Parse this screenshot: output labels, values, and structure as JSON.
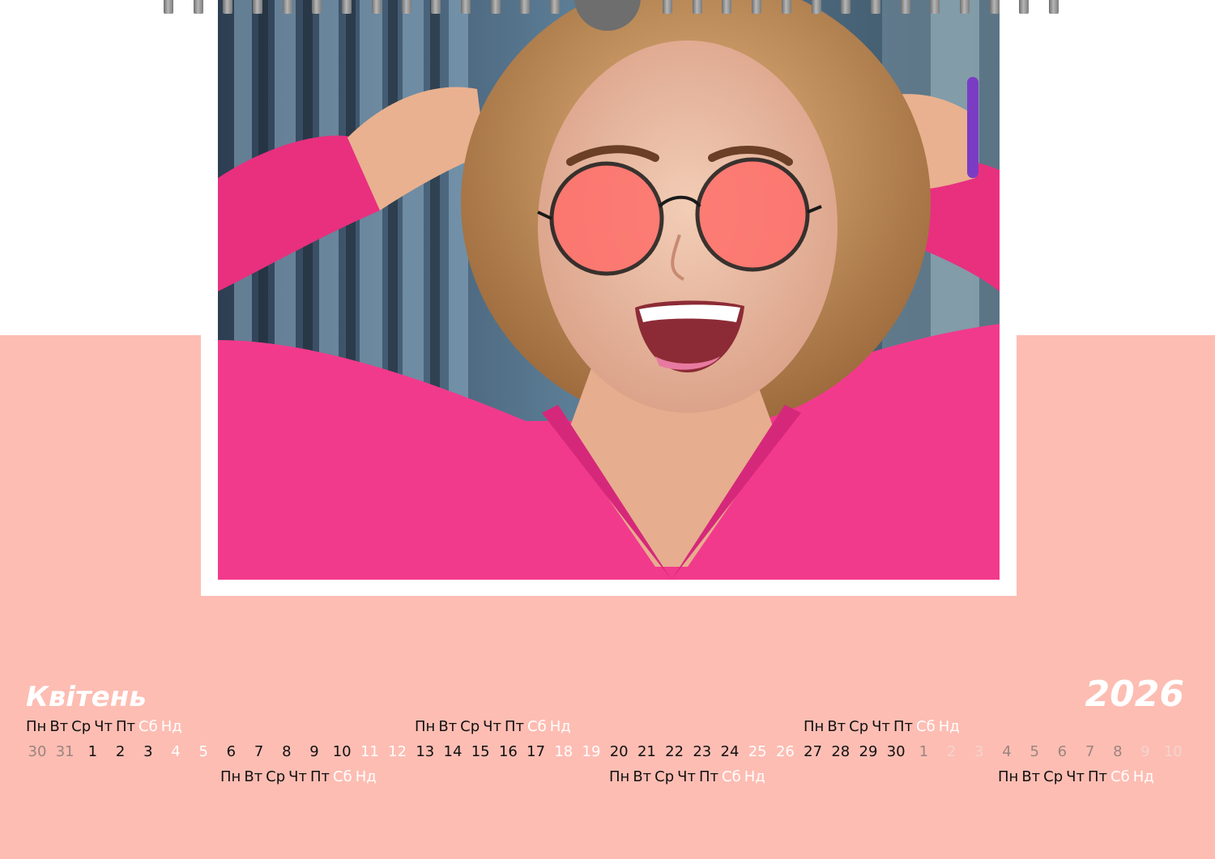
{
  "calendar": {
    "month": "Квітень",
    "year": "2026",
    "weekday_labels": [
      "Пн",
      "Вт",
      "Ср",
      "Чт",
      "Пт",
      "Сб",
      "Нд"
    ],
    "weekday_rows": 6,
    "days": [
      {
        "n": "30",
        "kind": "other"
      },
      {
        "n": "31",
        "kind": "other"
      },
      {
        "n": "1",
        "kind": "work"
      },
      {
        "n": "2",
        "kind": "work"
      },
      {
        "n": "3",
        "kind": "work"
      },
      {
        "n": "4",
        "kind": "weekend"
      },
      {
        "n": "5",
        "kind": "weekend"
      },
      {
        "n": "6",
        "kind": "work"
      },
      {
        "n": "7",
        "kind": "work"
      },
      {
        "n": "8",
        "kind": "work"
      },
      {
        "n": "9",
        "kind": "work"
      },
      {
        "n": "10",
        "kind": "work"
      },
      {
        "n": "11",
        "kind": "weekend"
      },
      {
        "n": "12",
        "kind": "weekend"
      },
      {
        "n": "13",
        "kind": "work"
      },
      {
        "n": "14",
        "kind": "work"
      },
      {
        "n": "15",
        "kind": "work"
      },
      {
        "n": "16",
        "kind": "work"
      },
      {
        "n": "17",
        "kind": "work"
      },
      {
        "n": "18",
        "kind": "weekend"
      },
      {
        "n": "19",
        "kind": "weekend"
      },
      {
        "n": "20",
        "kind": "work"
      },
      {
        "n": "21",
        "kind": "work"
      },
      {
        "n": "22",
        "kind": "work"
      },
      {
        "n": "23",
        "kind": "work"
      },
      {
        "n": "24",
        "kind": "work"
      },
      {
        "n": "25",
        "kind": "weekend"
      },
      {
        "n": "26",
        "kind": "weekend"
      },
      {
        "n": "27",
        "kind": "work"
      },
      {
        "n": "28",
        "kind": "work"
      },
      {
        "n": "29",
        "kind": "work"
      },
      {
        "n": "30",
        "kind": "work"
      },
      {
        "n": "1",
        "kind": "other"
      },
      {
        "n": "2",
        "kind": "faint"
      },
      {
        "n": "3",
        "kind": "faint"
      },
      {
        "n": "4",
        "kind": "other"
      },
      {
        "n": "5",
        "kind": "other"
      },
      {
        "n": "6",
        "kind": "other"
      },
      {
        "n": "7",
        "kind": "other"
      },
      {
        "n": "8",
        "kind": "other"
      },
      {
        "n": "9",
        "kind": "faint"
      },
      {
        "n": "10",
        "kind": "faint"
      }
    ]
  },
  "photo": {
    "subject": "smiling woman with curly blonde hair, round red-tinted glasses and a pink knit sweater"
  },
  "colors": {
    "band": "#fdbdb3",
    "ink": "#111111",
    "white": "#ffffff",
    "other_month": "#9a8580",
    "faint": "#f3d4ce",
    "sweater": "#f23a8c"
  }
}
